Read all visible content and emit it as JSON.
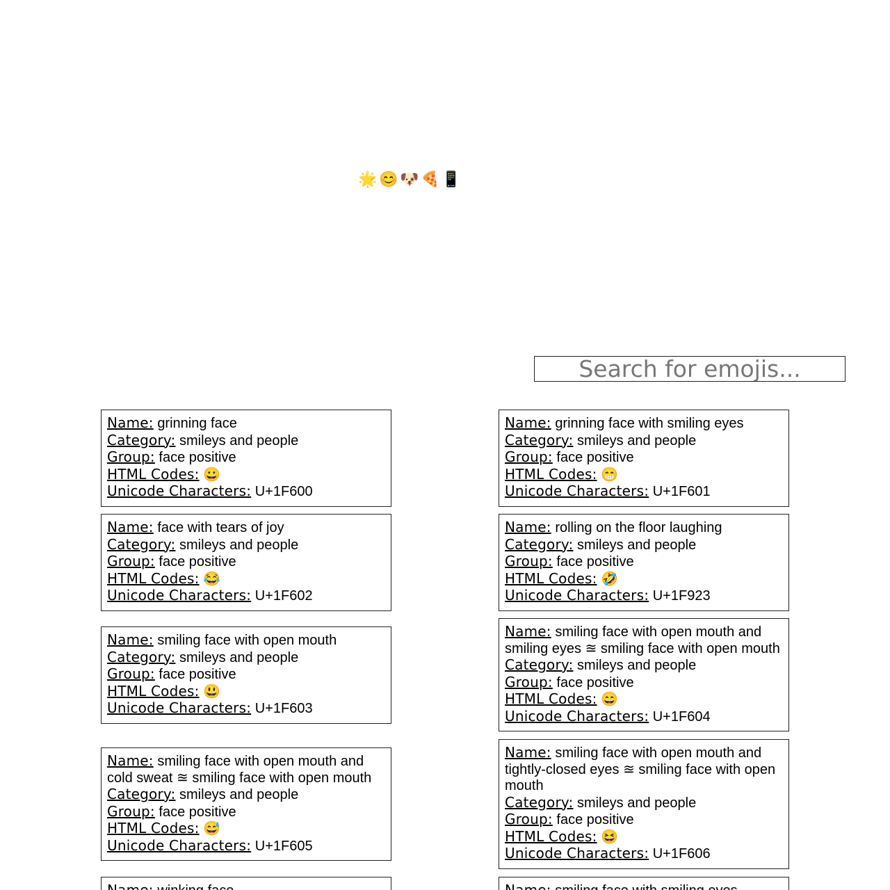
{
  "banner": {
    "emojis": [
      "🌟",
      "😊",
      "🐶",
      "🍕",
      "📱"
    ]
  },
  "search": {
    "placeholder": "Search for emojis..."
  },
  "labels": {
    "name": "Name:",
    "category": "Category:",
    "group": "Group:",
    "html_codes": "HTML Codes:",
    "unicode": "Unicode Characters:"
  },
  "left_cards": [
    {
      "name": "grinning face",
      "category": "smileys and people",
      "group": "face positive",
      "html": "😀",
      "unicode": "U+1F600"
    },
    {
      "name": "face with tears of joy",
      "category": "smileys and people",
      "group": "face positive",
      "html": "😂",
      "unicode": "U+1F602"
    },
    {
      "name": "smiling face with open mouth",
      "category": "smileys and people",
      "group": "face positive",
      "html": "😃",
      "unicode": "U+1F603"
    },
    {
      "name": "smiling face with open mouth and cold sweat ≊ smiling face with open mouth",
      "category": "smileys and people",
      "group": "face positive",
      "html": "😅",
      "unicode": "U+1F605"
    },
    {
      "name": "winking face",
      "category": "",
      "group": "",
      "html": "",
      "unicode": ""
    }
  ],
  "right_cards": [
    {
      "name": "grinning face with smiling eyes",
      "category": "smileys and people",
      "group": "face positive",
      "html": "😁",
      "unicode": "U+1F601"
    },
    {
      "name": "rolling on the floor laughing",
      "category": "smileys and people",
      "group": "face positive",
      "html": "🤣",
      "unicode": "U+1F923"
    },
    {
      "name": "smiling face with open mouth and smiling eyes ≊ smiling face with open mouth",
      "category": "smileys and people",
      "group": "face positive",
      "html": "😄",
      "unicode": "U+1F604"
    },
    {
      "name": "smiling face with open mouth and tightly-closed eyes ≊ smiling face with open mouth",
      "category": "smileys and people",
      "group": "face positive",
      "html": "😆",
      "unicode": "U+1F606"
    },
    {
      "name": "smiling face with smiling eyes",
      "category": "",
      "group": "",
      "html": "",
      "unicode": ""
    }
  ]
}
